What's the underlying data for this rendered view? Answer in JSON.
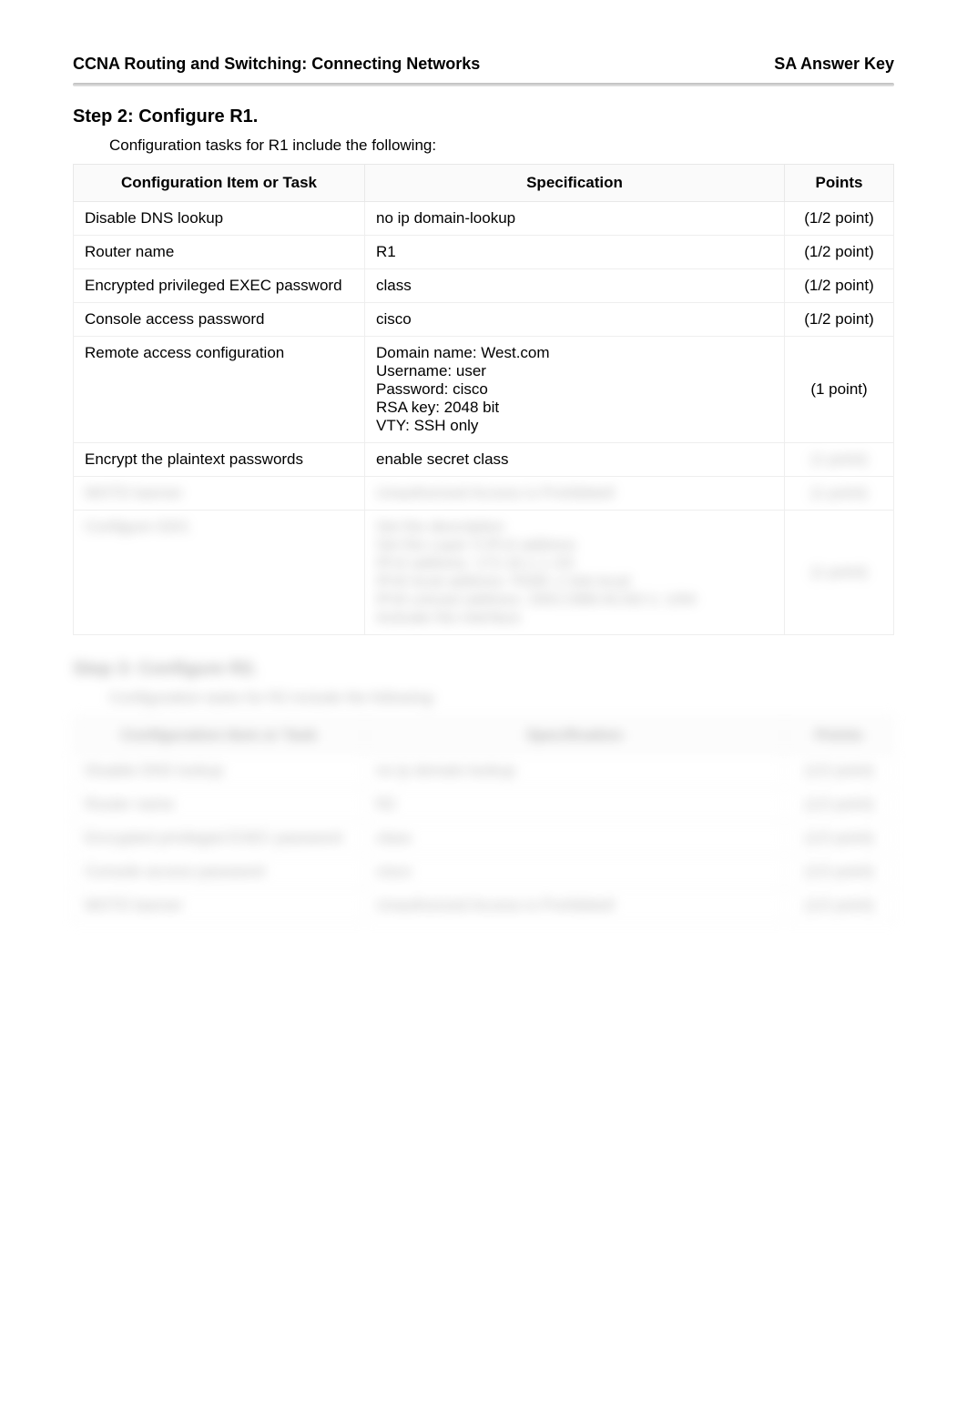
{
  "header": {
    "left": "CCNA Routing and Switching: Connecting Networks",
    "right": "SA Answer Key"
  },
  "step2": {
    "title": "Step 2: Configure R1.",
    "intro": "Configuration tasks for R1 include the following:",
    "columns": {
      "c1": "Configuration Item or Task",
      "c2": "Specification",
      "c3": "Points"
    },
    "rows": [
      {
        "item": "Disable DNS lookup",
        "spec": "no ip domain-lookup",
        "points": "(1/2 point)"
      },
      {
        "item": "Router name",
        "spec": "R1",
        "points": "(1/2 point)"
      },
      {
        "item": "Encrypted privileged EXEC password",
        "spec": "class",
        "points": "(1/2 point)"
      },
      {
        "item": "Console access password",
        "spec": "cisco",
        "points": "(1/2 point)"
      },
      {
        "item": "Remote access configuration",
        "spec": "Domain name: West.com\nUsername: user\nPassword: cisco\nRSA key: 2048 bit\nVTY: SSH only",
        "points": "(1 point)"
      },
      {
        "item": "Encrypt the plaintext passwords",
        "spec": "enable secret class",
        "points": "(1 point)"
      },
      {
        "item": "MOTD banner",
        "spec": "Unauthorized Access is Prohibited!",
        "points": "(1 point)"
      },
      {
        "item": "Configure G0/1",
        "spec": "Set the description\nSet the Layer 3 IPv4 address\nIPv4 address: 172.16.1.1 /24\nIPv6 local address: FE80::1 link-local\nIPv6 unicast address: 2001:DB8:ACAD:1::1/64\nActivate the interface",
        "points": "(1 point)"
      }
    ]
  },
  "step3": {
    "title": "Step 3: Configure R2.",
    "intro": "Configuration tasks for R2 include the following:",
    "columns": {
      "c1": "Configuration Item or Task",
      "c2": "Specification",
      "c3": "Points"
    },
    "rows": [
      {
        "item": "Disable DNS lookup",
        "spec": "no ip domain-lookup",
        "points": "(1/2 point)"
      },
      {
        "item": "Router name",
        "spec": "R2",
        "points": "(1/2 point)"
      },
      {
        "item": "Encrypted privileged EXEC password",
        "spec": "class",
        "points": "(1/2 point)"
      },
      {
        "item": "Console access password",
        "spec": "cisco",
        "points": "(1/2 point)"
      },
      {
        "item": "MOTD banner",
        "spec": "Unauthorized Access is Prohibited!",
        "points": "(1/2 point)"
      }
    ]
  }
}
